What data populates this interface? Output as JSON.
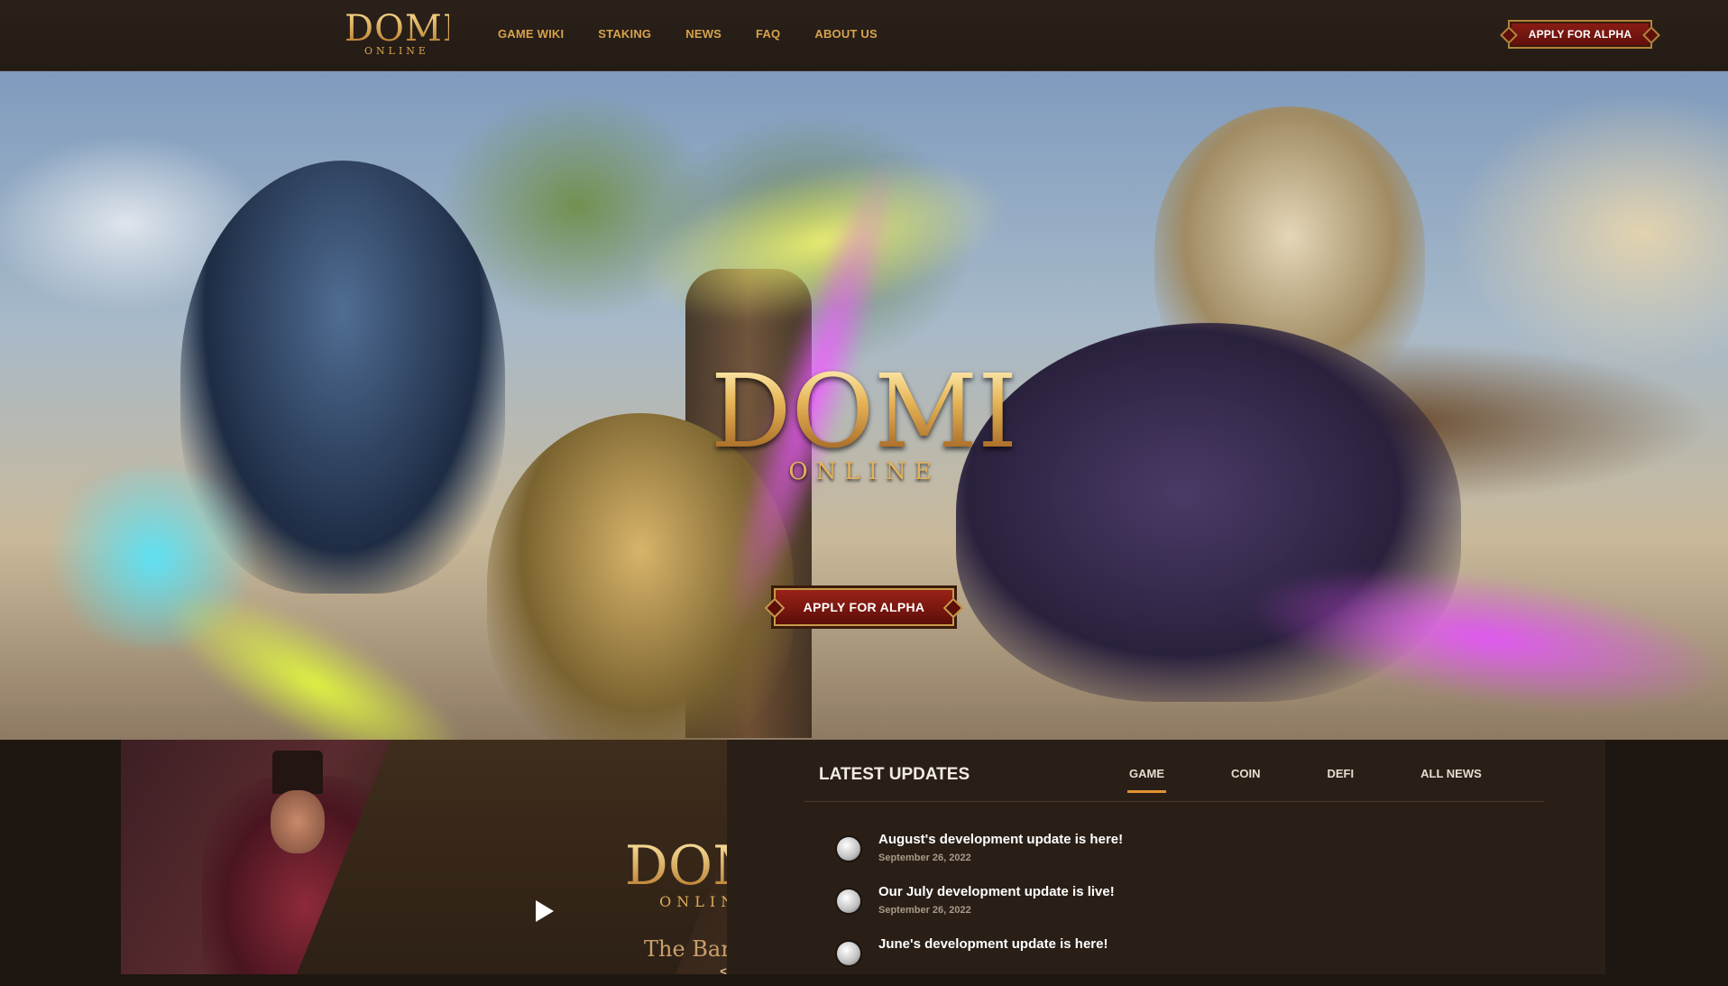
{
  "header": {
    "logo_word": "DOMI",
    "logo_sub": "ONLINE",
    "nav": [
      {
        "label": "GAME WIKI"
      },
      {
        "label": "STAKING"
      },
      {
        "label": "NEWS"
      },
      {
        "label": "FAQ"
      },
      {
        "label": "ABOUT US"
      }
    ],
    "apply_label": "APPLY FOR ALPHA"
  },
  "hero": {
    "logo_word": "DOMI",
    "logo_sub": "ONLINE",
    "apply_label": "APPLY FOR ALPHA"
  },
  "video": {
    "logo_word": "DOMI",
    "logo_sub": "ONLINE",
    "caption": "The Bard of",
    "prev": "<",
    "next": ">"
  },
  "updates": {
    "title": "LATEST UPDATES",
    "tabs": [
      {
        "label": "GAME",
        "active": true
      },
      {
        "label": "COIN"
      },
      {
        "label": "DEFI"
      },
      {
        "label": "ALL NEWS"
      }
    ],
    "items": [
      {
        "title": "August's development update is here!",
        "date": "September 26, 2022"
      },
      {
        "title": "Our July development update is live!",
        "date": "September 26, 2022"
      },
      {
        "title": "June's development update is here!",
        "date": ""
      }
    ]
  },
  "colors": {
    "accent": "#d6a34c",
    "button_red": "#8c1d15",
    "tab_underline": "#e3922f"
  }
}
